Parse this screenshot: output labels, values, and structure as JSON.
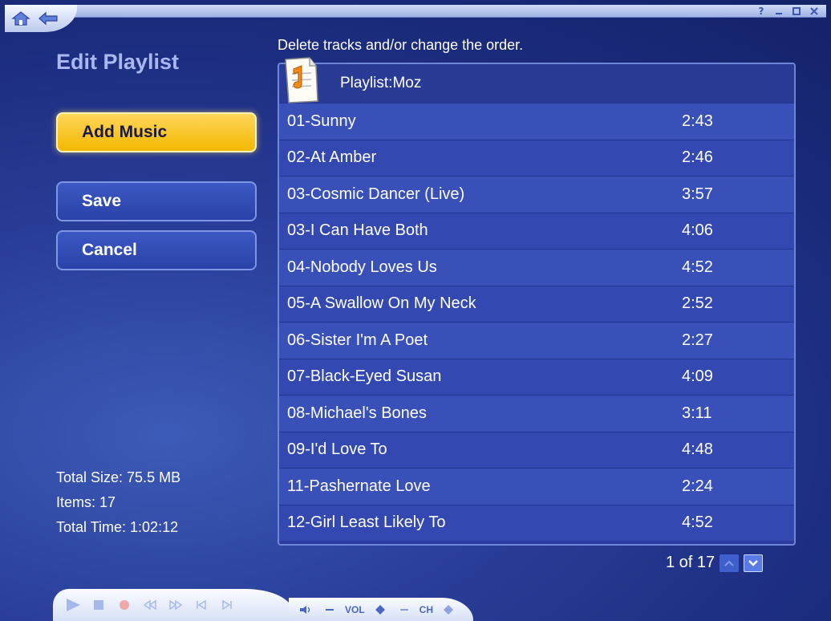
{
  "page": {
    "title": "Edit Playlist",
    "instructions": "Delete tracks and/or change the order."
  },
  "buttons": {
    "add_music": "Add Music",
    "save": "Save",
    "cancel": "Cancel"
  },
  "stats": {
    "total_size": "Total Size: 75.5 MB",
    "items": "Items: 17",
    "total_time": "Total Time: 1:02:12"
  },
  "playlist": {
    "header": "Playlist:Moz",
    "tracks": [
      {
        "name": "01-Sunny",
        "duration": "2:43"
      },
      {
        "name": "02-At Amber",
        "duration": "2:46"
      },
      {
        "name": "03-Cosmic Dancer (Live)",
        "duration": "3:57"
      },
      {
        "name": "03-I Can Have Both",
        "duration": "4:06"
      },
      {
        "name": "04-Nobody Loves Us",
        "duration": "4:52"
      },
      {
        "name": "05-A Swallow On My Neck",
        "duration": "2:52"
      },
      {
        "name": "06-Sister I'm A Poet",
        "duration": "2:27"
      },
      {
        "name": "07-Black-Eyed Susan",
        "duration": "4:09"
      },
      {
        "name": "08-Michael's Bones",
        "duration": "3:11"
      },
      {
        "name": "09-I'd Love To",
        "duration": "4:48"
      },
      {
        "name": "11-Pashernate Love",
        "duration": "2:24"
      },
      {
        "name": "12-Girl Least Likely To",
        "duration": "4:52"
      }
    ]
  },
  "pager": {
    "text": "1 of 17"
  },
  "transport": {
    "vol_label": "VOL",
    "ch_label": "CH"
  },
  "icons": {
    "home": "home-icon",
    "back": "back-arrow-icon",
    "help": "help-icon",
    "minimize": "minimize-icon",
    "maximize": "maximize-icon",
    "close": "close-icon",
    "playlist_doc": "playlist-document-icon"
  },
  "colors": {
    "accent_yellow": "#f3b800",
    "panel_blue": "#3850b8",
    "title_lavender": "#a9b8ee"
  }
}
